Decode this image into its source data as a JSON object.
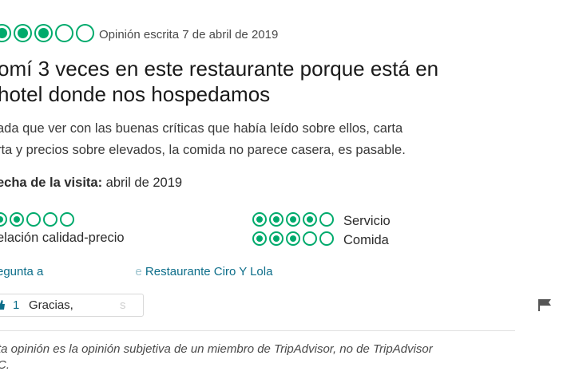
{
  "review": {
    "rating": 3,
    "rating_max": 5,
    "written_date": "Opinión escrita 7 de abril de 2019",
    "title": "omí 3 veces en este restaurante porque está en hotel donde nos hospedamos",
    "title_line1": "omí 3 veces en este restaurante porque está en",
    "title_line2": "hotel donde nos hospedamos",
    "body_line1": "ada que ver con las buenas críticas que había leído sobre ellos, carta",
    "body_line2": "rta y precios sobre elevados, la comida no parece casera, es pasable.",
    "visit_label": "echa de la visita:",
    "visit_value": "abril de 2019"
  },
  "subratings": [
    {
      "label": "elación calidad-precio",
      "rating": 2
    },
    {
      "label": "Servicio",
      "rating": 4
    },
    {
      "label": "Comida",
      "rating": 3
    }
  ],
  "ask": {
    "prefix": "egunta a",
    "suffix": "Restaurante Ciro Y Lola"
  },
  "thanks": {
    "count": "1",
    "label": "Gracias,"
  },
  "disclaimer": {
    "line1": "ta opinión es la opinión subjetiva de un miembro de TripAdvisor, no de TripAdvisor",
    "line2": "C."
  },
  "icons": {
    "rating": "bubble-rating-icon",
    "thumb": "thumbs-up-icon",
    "flag": "flag-icon"
  },
  "colors": {
    "bubble": "#00aa6c",
    "link": "#0d6e8a",
    "text": "#2c2c2c"
  }
}
